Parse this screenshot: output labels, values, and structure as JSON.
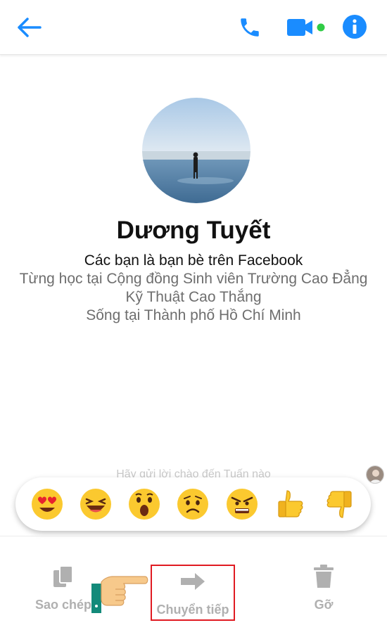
{
  "header": {
    "back_icon": "arrow-left-icon",
    "call_icon": "phone-icon",
    "video_icon": "video-camera-icon",
    "info_icon": "info-icon",
    "accent": "#1a8cff",
    "online": "#31cc46"
  },
  "profile": {
    "name": "Dương Tuyết",
    "friend_status": "Các bạn là bạn bè trên Facebook",
    "education": "Từng học tại Cộng đồng Sinh viên Trường Cao Đẳng Kỹ Thuật Cao Thắng",
    "location": "Sống tại Thành phố Hồ Chí Minh"
  },
  "hint": "Hãy gửi lời chào đến Tuấn nào",
  "reactions": [
    "heart-eyes",
    "laughing",
    "wow",
    "sad",
    "angry",
    "thumbs-up",
    "thumbs-down"
  ],
  "actions": {
    "copy": "Sao chép",
    "forward": "Chuyển tiếp",
    "unsend": "Gỡ"
  }
}
